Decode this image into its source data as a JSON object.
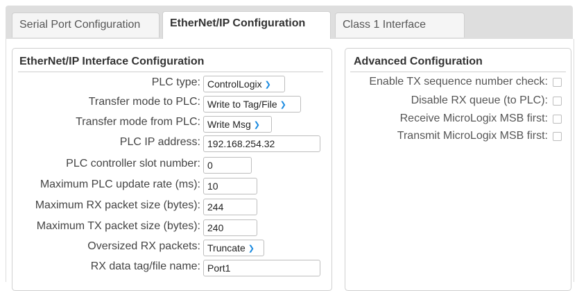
{
  "tabs": [
    {
      "label": "Serial Port Configuration",
      "active": false
    },
    {
      "label": "EtherNet/IP Configuration",
      "active": true
    },
    {
      "label": "Class 1 Interface",
      "active": false
    }
  ],
  "interface_config": {
    "title": "EtherNet/IP Interface Configuration",
    "fields": [
      {
        "label": "PLC type:",
        "value": "ControlLogix",
        "kind": "select"
      },
      {
        "label": "Transfer mode to PLC:",
        "value": "Write to Tag/File",
        "kind": "select"
      },
      {
        "label": "Transfer mode from PLC:",
        "value": "Write Msg",
        "kind": "select"
      },
      {
        "label": "PLC IP address:",
        "value": "192.168.254.32",
        "kind": "text"
      },
      {
        "label": "PLC controller slot number:",
        "value": "0",
        "kind": "text"
      },
      {
        "label": "Maximum PLC update rate (ms):",
        "value": "10",
        "kind": "text"
      },
      {
        "label": "Maximum RX packet size (bytes):",
        "value": "244",
        "kind": "text"
      },
      {
        "label": "Maximum TX packet size (bytes):",
        "value": "240",
        "kind": "text"
      },
      {
        "label": "Oversized RX packets:",
        "value": "Truncate",
        "kind": "select"
      },
      {
        "label": "RX data tag/file name:",
        "value": "Port1",
        "kind": "text"
      }
    ]
  },
  "advanced_config": {
    "title": "Advanced Configuration",
    "options": [
      {
        "label": "Enable TX sequence number check:",
        "checked": false
      },
      {
        "label": "Disable RX queue (to PLC):",
        "checked": false
      },
      {
        "label": "Receive MicroLogix MSB first:",
        "checked": false
      },
      {
        "label": "Transmit MicroLogix MSB first:",
        "checked": false
      }
    ]
  },
  "icons": {
    "dropdown": "chevron-down-icon"
  },
  "colors": {
    "accent": "#1a8ae0",
    "tabbar": "#dedede",
    "border": "#cfcfcf"
  }
}
